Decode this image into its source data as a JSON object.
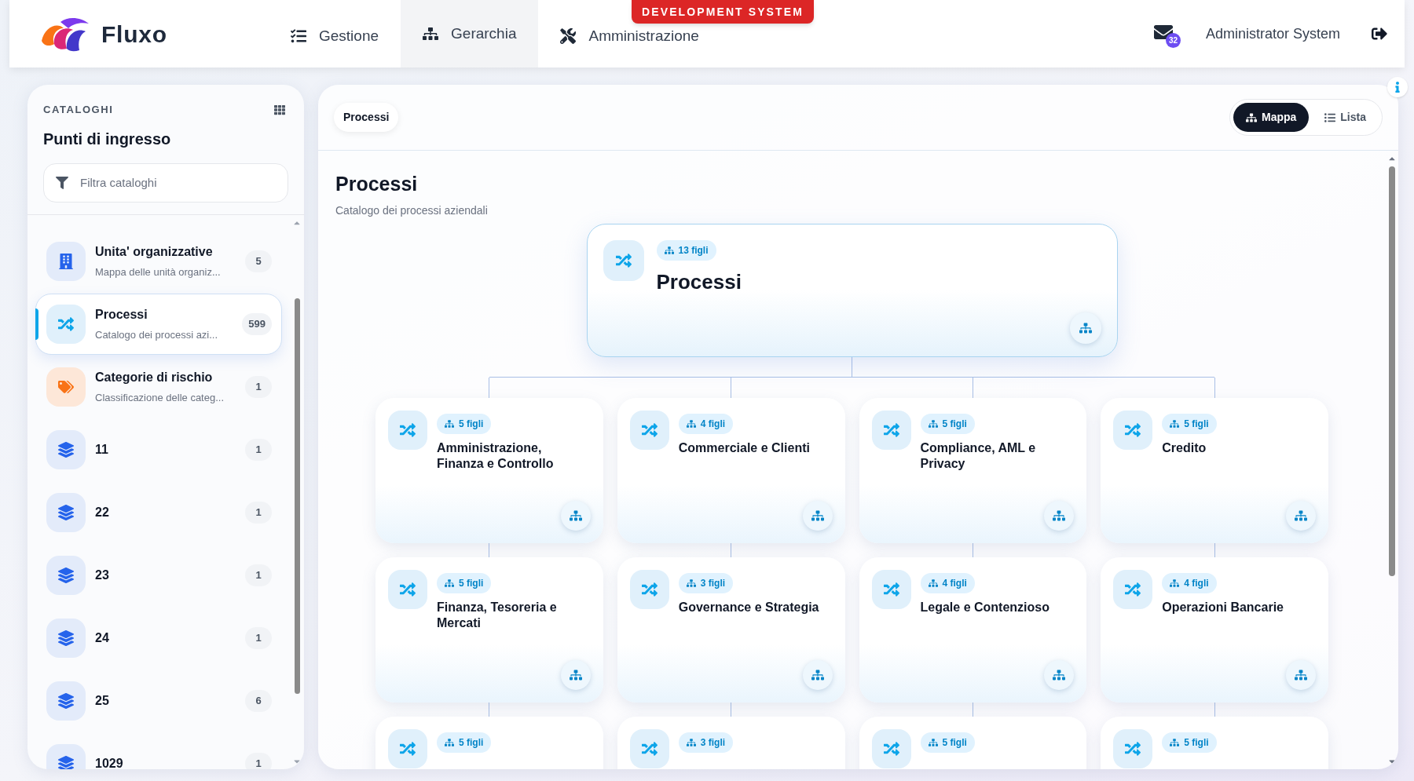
{
  "header": {
    "logo_text": "Fluxo",
    "environment_badge": "DEVELOPMENT SYSTEM",
    "nav": [
      {
        "label": "Gestione",
        "kind": "tasks",
        "selected": false
      },
      {
        "label": "Gerarchia",
        "kind": "sitemap",
        "selected": true
      },
      {
        "label": "Amministrazione",
        "kind": "tools",
        "selected": false
      }
    ],
    "mail_count": "32",
    "user": "Administrator System"
  },
  "sidebar": {
    "eyebrow": "CATALOGHI",
    "title": "Punti di ingresso",
    "filter": {
      "placeholder": "Filtra cataloghi"
    },
    "items": [
      {
        "kind": "building",
        "title": "Unita' organizzative",
        "subtitle": "Mappa delle unità organiz...",
        "count": "5",
        "selected": false
      },
      {
        "kind": "shuffle",
        "title": "Processi",
        "subtitle": "Catalogo dei processi azi...",
        "count": "599",
        "selected": true
      },
      {
        "kind": "tags",
        "title": "Categorie di rischio",
        "subtitle": "Classificazione delle categ...",
        "count": "1",
        "selected": false
      },
      {
        "kind": "layers",
        "title": "11",
        "count": "1",
        "selected": false
      },
      {
        "kind": "layers",
        "title": "22",
        "count": "1",
        "selected": false
      },
      {
        "kind": "layers",
        "title": "23",
        "count": "1",
        "selected": false
      },
      {
        "kind": "layers",
        "title": "24",
        "count": "1",
        "selected": false
      },
      {
        "kind": "layers",
        "title": "25",
        "count": "6",
        "selected": false
      },
      {
        "kind": "layers",
        "title": "1029",
        "count": "1",
        "selected": false
      }
    ]
  },
  "main": {
    "breadcrumb": "Processi",
    "view_toggle": [
      {
        "label": "Mappa",
        "kind": "map",
        "selected": true
      },
      {
        "label": "Lista",
        "kind": "list",
        "selected": false
      }
    ],
    "title": "Processi",
    "subtitle": "Catalogo dei processi aziendali",
    "root": {
      "badge": "13 figli",
      "title": "Processi"
    },
    "children": [
      {
        "badge": "5 figli",
        "title": "Amministrazione, Finanza e Controllo"
      },
      {
        "badge": "4 figli",
        "title": "Commerciale e Clienti"
      },
      {
        "badge": "5 figli",
        "title": "Compliance, AML e Privacy"
      },
      {
        "badge": "5 figli",
        "title": "Credito"
      },
      {
        "badge": "5 figli",
        "title": "Finanza, Tesoreria e Mercati"
      },
      {
        "badge": "3 figli",
        "title": "Governance e Strategia"
      },
      {
        "badge": "4 figli",
        "title": "Legale e Contenzioso"
      },
      {
        "badge": "4 figli",
        "title": "Operazioni Bancarie"
      },
      {
        "badge": "5 figli"
      },
      {
        "badge": "3 figli"
      },
      {
        "badge": "5 figli"
      },
      {
        "badge": "5 figli"
      }
    ]
  }
}
